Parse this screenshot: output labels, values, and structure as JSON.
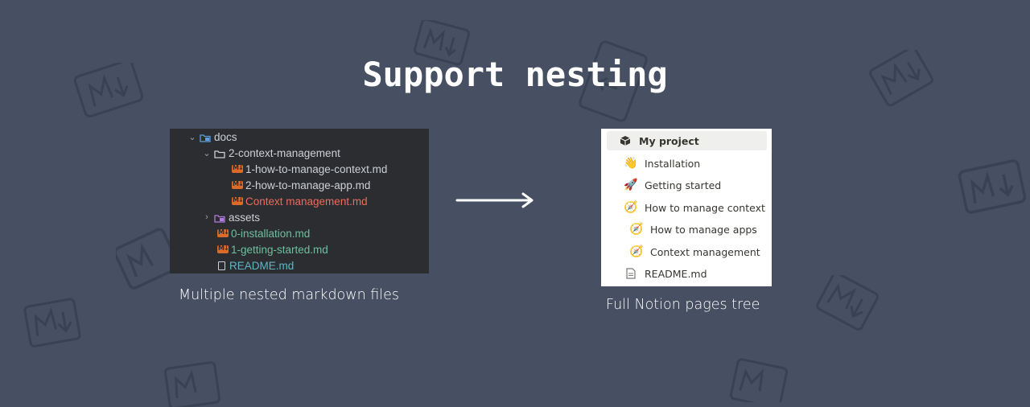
{
  "title": "Support nesting",
  "bg_logo": "markdown-logo",
  "ide_tree": {
    "rows": [
      {
        "label": "docs",
        "icon": "folder-icon",
        "expanded": true
      },
      {
        "label": "2-context-management",
        "icon": "folder-icon",
        "expanded": true
      },
      {
        "label": "1-how-to-manage-context.md",
        "icon": "markdown-file-icon"
      },
      {
        "label": "2-how-to-manage-app.md",
        "icon": "markdown-file-icon"
      },
      {
        "label": "Context management.md",
        "icon": "markdown-file-icon"
      },
      {
        "label": "assets",
        "icon": "folder-icon",
        "expanded": false
      },
      {
        "label": "0-installation.md",
        "icon": "markdown-file-icon"
      },
      {
        "label": "1-getting-started.md",
        "icon": "markdown-file-icon"
      },
      {
        "label": "README.md",
        "icon": "readme-file-icon"
      }
    ]
  },
  "left_caption": "Multiple nested markdown files",
  "arrow_icon": "arrow-right-icon",
  "notion_tree": {
    "rows": [
      {
        "label": "My project",
        "icon": "cube-icon"
      },
      {
        "label": "Installation",
        "icon": "waving-hand-icon"
      },
      {
        "label": "Getting started",
        "icon": "rocket-icon"
      },
      {
        "label": "How to manage context",
        "icon": "compass-icon"
      },
      {
        "label": "How to manage apps",
        "icon": "compass-icon"
      },
      {
        "label": "Context management",
        "icon": "compass-icon"
      },
      {
        "label": "README.md",
        "icon": "document-icon"
      }
    ]
  },
  "right_caption": "Full Notion pages tree",
  "colors": {
    "background": "#465062",
    "ide_background": "#2b2d30",
    "markdown_badge": "#d96c2a",
    "file_red": "#ef6b5a",
    "file_green": "#6fbf9e"
  }
}
